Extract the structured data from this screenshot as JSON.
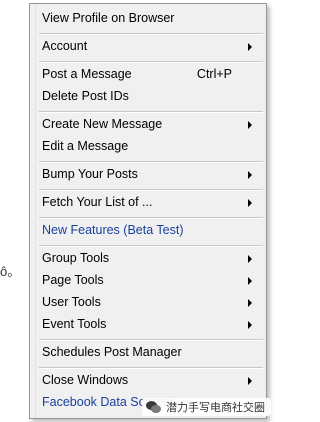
{
  "background": {
    "fragment_text": "ô。"
  },
  "menu": {
    "items": [
      {
        "label": "View Profile on Browser",
        "shortcut": "",
        "submenu": false,
        "color": "#000000"
      },
      {
        "label": "Account",
        "shortcut": "",
        "submenu": true,
        "color": "#000000"
      },
      {
        "label": "Post a Message",
        "shortcut": "Ctrl+P",
        "submenu": false,
        "color": "#000000"
      },
      {
        "label": "Delete Post IDs",
        "shortcut": "",
        "submenu": false,
        "color": "#000000"
      },
      {
        "label": "Create New Message",
        "shortcut": "",
        "submenu": true,
        "color": "#000000"
      },
      {
        "label": "Edit a Message",
        "shortcut": "",
        "submenu": false,
        "color": "#000000"
      },
      {
        "label": "Bump Your Posts",
        "shortcut": "",
        "submenu": true,
        "color": "#000000"
      },
      {
        "label": "Fetch Your List of ...",
        "shortcut": "",
        "submenu": true,
        "color": "#000000"
      },
      {
        "label": "New Features (Beta Test)",
        "shortcut": "",
        "submenu": false,
        "color": "#1a3fa0"
      },
      {
        "label": "Group Tools",
        "shortcut": "",
        "submenu": true,
        "color": "#000000"
      },
      {
        "label": "Page Tools",
        "shortcut": "",
        "submenu": true,
        "color": "#000000"
      },
      {
        "label": "User Tools",
        "shortcut": "",
        "submenu": true,
        "color": "#000000"
      },
      {
        "label": "Event Tools",
        "shortcut": "",
        "submenu": true,
        "color": "#000000"
      },
      {
        "label": "Schedules Post Manager",
        "shortcut": "",
        "submenu": false,
        "color": "#000000"
      },
      {
        "label": "Close Windows",
        "shortcut": "",
        "submenu": true,
        "color": "#000000"
      },
      {
        "label": "Facebook Data Scraper",
        "shortcut": "",
        "submenu": false,
        "color": "#1a3fa0"
      }
    ]
  },
  "watermark": {
    "badge_text": "潜力手写电商社交圈",
    "icon": "wechat-icon"
  }
}
